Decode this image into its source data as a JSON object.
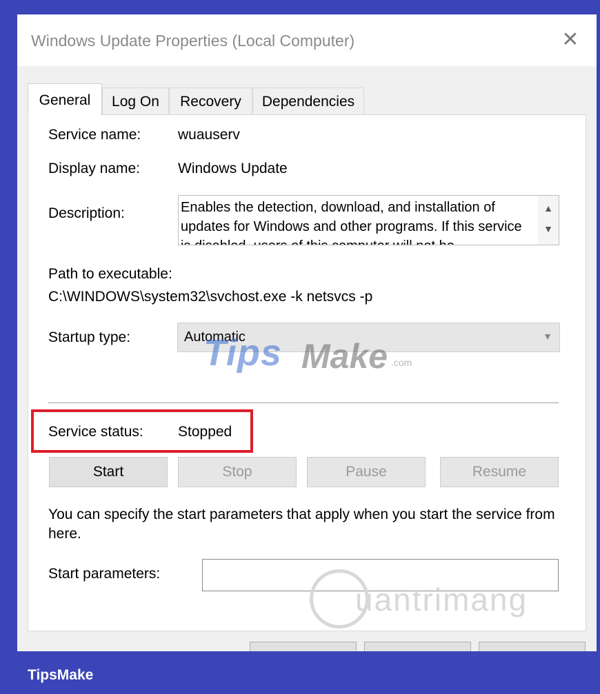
{
  "window": {
    "title": "Windows Update Properties (Local Computer)",
    "close_glyph": "✕"
  },
  "tabs": [
    {
      "label": "General",
      "active": true
    },
    {
      "label": "Log On",
      "active": false
    },
    {
      "label": "Recovery",
      "active": false
    },
    {
      "label": "Dependencies",
      "active": false
    }
  ],
  "general": {
    "service_name_label": "Service name:",
    "service_name_value": "wuauserv",
    "display_name_label": "Display name:",
    "display_name_value": "Windows Update",
    "description_label": "Description:",
    "description_value": "Enables the detection, download, and installation of updates for Windows and other programs. If this service is disabled, users of this computer will not be",
    "path_label": "Path to executable:",
    "path_value": "C:\\WINDOWS\\system32\\svchost.exe -k netsvcs -p",
    "startup_type_label": "Startup type:",
    "startup_type_value": "Automatic",
    "service_status_label": "Service status:",
    "service_status_value": "Stopped",
    "buttons": {
      "start": "Start",
      "stop": "Stop",
      "pause": "Pause",
      "resume": "Resume"
    },
    "info_text": "You can specify the start parameters that apply when you start the service from here.",
    "start_params_label": "Start parameters:",
    "start_params_value": ""
  },
  "watermarks": {
    "tips": "Tips",
    "make": "Make",
    "com": ".com",
    "quantrimang": "uantrimang"
  },
  "footer": {
    "brand": "TipsMake"
  },
  "colors": {
    "background": "#3b45b8",
    "highlight": "#dd1e2b"
  }
}
